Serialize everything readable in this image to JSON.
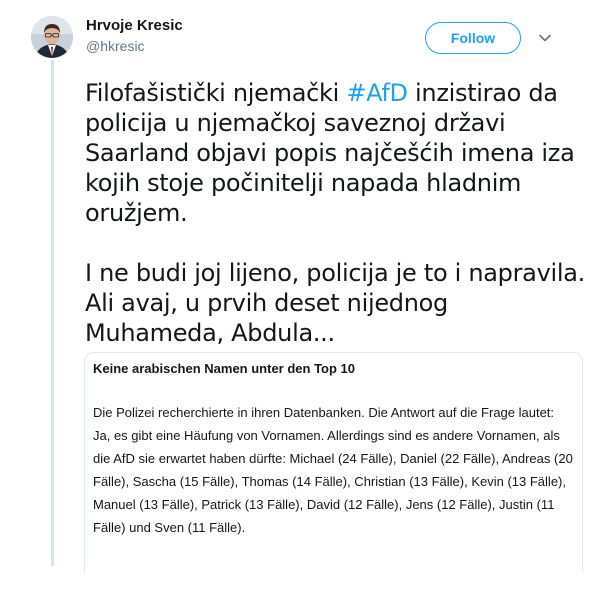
{
  "author": {
    "name": "Hrvoje Kresic",
    "handle": "@hkresic"
  },
  "actions": {
    "follow_label": "Follow"
  },
  "tweet": {
    "para1_before": "Filofašistički njemački ",
    "hashtag": "#AfD",
    "para1_after": " inzistirao da policija u njemačkoj saveznoj državi Saarland objavi popis najčešćih imena iza kojih stoje počinitelji napada hladnim oružjem.",
    "para2": "I ne budi joj lijeno, policija je to i napravila. Ali avaj, u prvih deset nijednog Muhameda, Abdula..."
  },
  "quote_card": {
    "title": "Keine arabischen Namen unter den Top 10",
    "body": "Die Polizei recherchierte in ihren Datenbanken. Die Antwort auf die Frage lautet: Ja, es gibt eine Häufung von Vornamen. Allerdings sind es andere Vornamen, als die AfD sie erwartet haben dürfte: Michael (24 Fälle), Daniel (22 Fälle), Andreas (20 Fälle), Sascha (15 Fälle), Thomas (14 Fälle), Christian (13 Fälle), Kevin (13 Fälle), Manuel (13 Fälle), Patrick (13 Fälle), David (12 Fälle), Jens (12 Fälle), Justin (11 Fälle) und Sven (11 Fälle)."
  },
  "colors": {
    "accent": "#1da1f2",
    "thread_rail": "#cfe4f7",
    "secondary_text": "#657786"
  },
  "icons": {
    "avatar": "avatar-photo",
    "menu": "chevron-down-icon"
  }
}
